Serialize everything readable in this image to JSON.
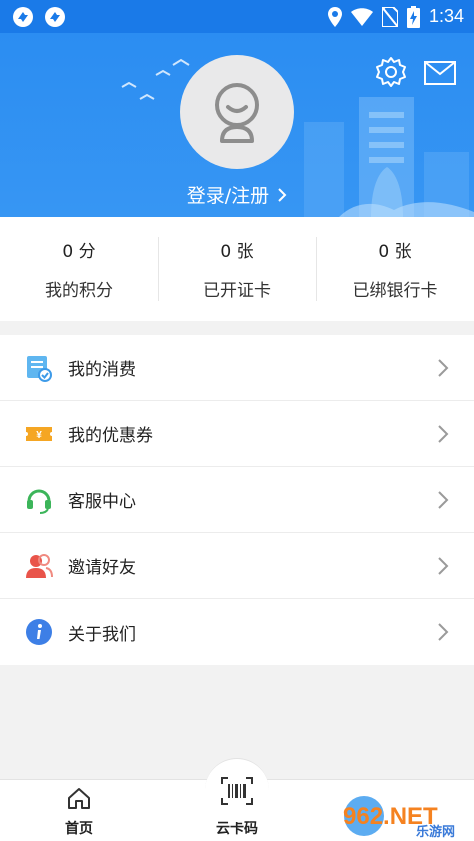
{
  "status_bar": {
    "time": "1:34"
  },
  "profile": {
    "login_text": "登录/注册"
  },
  "stats": [
    {
      "value": "0 分",
      "label": "我的积分"
    },
    {
      "value": "0 张",
      "label": "已开证卡"
    },
    {
      "value": "0 张",
      "label": "已绑银行卡"
    }
  ],
  "menu": [
    {
      "label": "我的消费",
      "icon": "receipt-icon"
    },
    {
      "label": "我的优惠券",
      "icon": "coupon-icon"
    },
    {
      "label": "客服中心",
      "icon": "headset-icon"
    },
    {
      "label": "邀请好友",
      "icon": "invite-friend-icon"
    },
    {
      "label": "关于我们",
      "icon": "info-icon"
    }
  ],
  "tabbar": {
    "home_label": "首页",
    "card_label": "云卡码"
  },
  "watermark": {
    "text": "962.NET",
    "subtext": "乐游网"
  },
  "colors": {
    "header_blue": "#2b8df2",
    "accent_orange": "#f5a623",
    "accent_green": "#3cb55a",
    "accent_red": "#e9544a",
    "accent_blue": "#3d7fe6"
  }
}
